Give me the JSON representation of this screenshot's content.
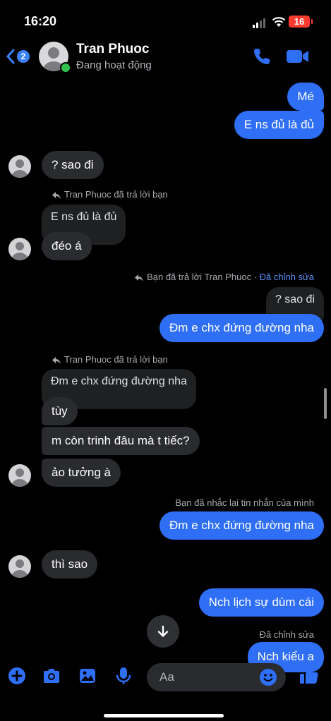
{
  "status_bar": {
    "time": "16:20",
    "battery": "16"
  },
  "header": {
    "back_badge": "2",
    "contact_name": "Tran Phuoc",
    "contact_status": "Đang hoạt động"
  },
  "messages": {
    "m1": "Mé",
    "m2": "E ns đủ là đủ",
    "m3": "? sao đi",
    "reply1_meta": "Tran Phuoc đã trả lời bạn",
    "m4_quoted": "E ns đủ là đủ",
    "m4": "đéo á",
    "reply2_meta_prefix": "Bạn đã trả lời Tran Phuoc · ",
    "reply2_meta_edited": "Đã chỉnh sửa",
    "m5_quoted": "? sao đi",
    "m5": "Đm e chx đứng đường nha",
    "reply3_meta": "Tran Phuoc đã trả lời bạn",
    "m6_quoted": "Đm e chx đứng đường nha",
    "m6": "tùy",
    "m7": "m còn trinh đâu mà t tiếc?",
    "m8": "ảo tưởng à",
    "remind_meta": "Bạn đã nhắc lại tin nhắn của mình",
    "m9": "Đm e chx đứng đường nha",
    "m10": "thì sao",
    "m11": "Nch lịch sự dùm cái",
    "edited_meta": "Đã chỉnh sửa",
    "m12": "Nch kiểu a"
  },
  "composer": {
    "placeholder": "Aa"
  },
  "colors": {
    "accent": "#2f6ff6",
    "them_bubble": "#2a2b2e",
    "online": "#31c24d"
  },
  "icons": [
    "chevron-left-icon",
    "phone-icon",
    "video-camera-icon",
    "plus-icon",
    "camera-icon",
    "image-icon",
    "microphone-icon",
    "smile-icon",
    "thumbs-up-icon",
    "arrow-down-icon",
    "reply-arrow-icon"
  ]
}
